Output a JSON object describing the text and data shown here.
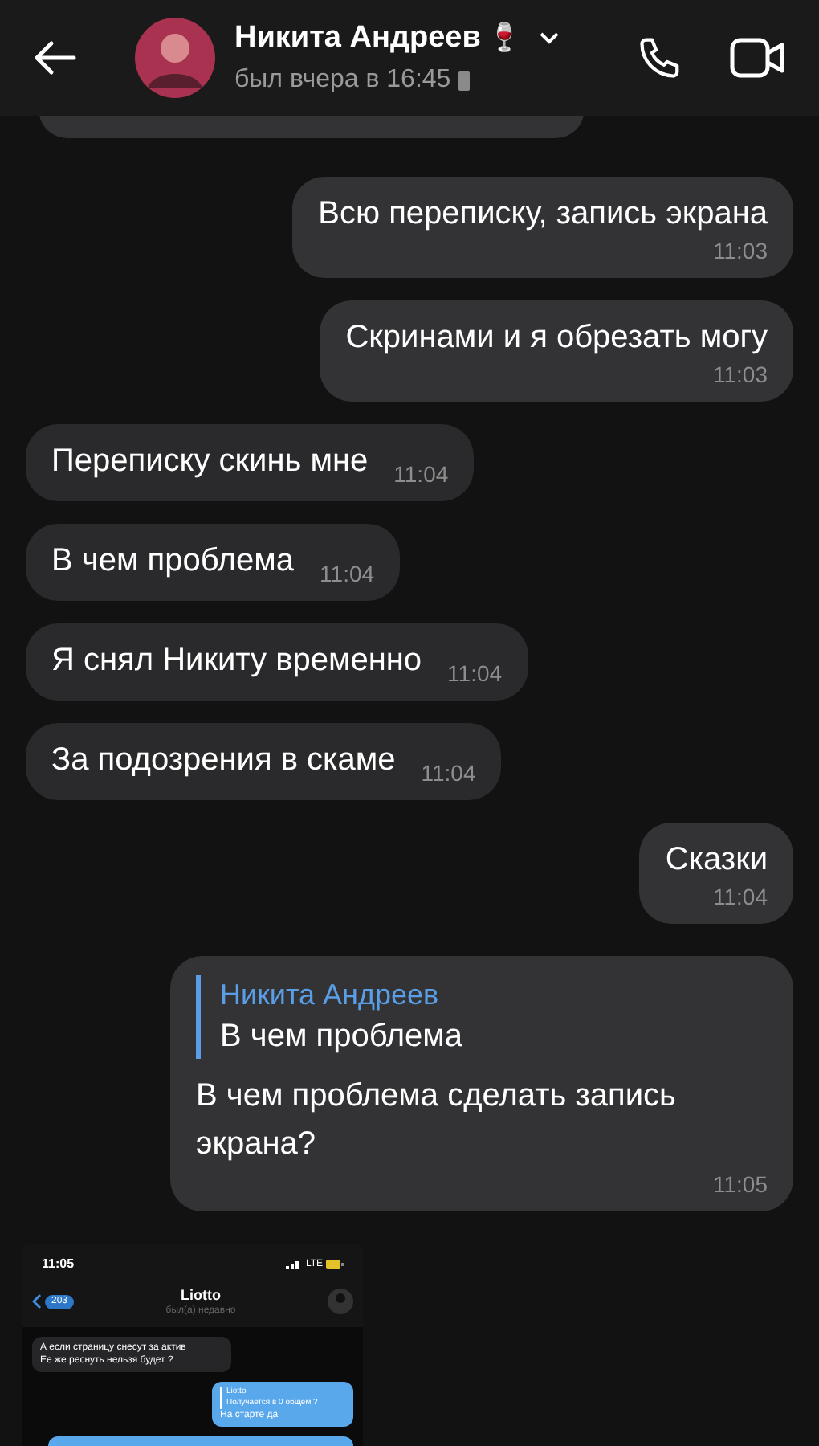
{
  "header": {
    "title": "Никита Андреев",
    "emoji": "🍷",
    "status": "был вчера в 16:45"
  },
  "messages": [
    {
      "kind": "partial",
      "outgoing": true
    },
    {
      "kind": "text",
      "outgoing": true,
      "text": "Всю переписку, запись экрана",
      "time": "11:03"
    },
    {
      "kind": "text",
      "outgoing": true,
      "text": "Скринами и я обрезать могу",
      "time": "11:03"
    },
    {
      "kind": "text",
      "outgoing": false,
      "text": "Переписку скинь мне",
      "time": "11:04"
    },
    {
      "kind": "text",
      "outgoing": false,
      "text": "В чем проблема",
      "time": "11:04"
    },
    {
      "kind": "text",
      "outgoing": false,
      "text": "Я снял Никиту временно",
      "time": "11:04"
    },
    {
      "kind": "text",
      "outgoing": false,
      "text": "За подозрения в скаме",
      "time": "11:04"
    },
    {
      "kind": "text",
      "outgoing": true,
      "text": "Сказки",
      "time": "11:04"
    },
    {
      "kind": "reply",
      "outgoing": true,
      "reply_author": "Никита Андреев",
      "reply_text": "В чем проблема",
      "text": "В чем проблема сделать запись экрана?",
      "time": "11:05"
    },
    {
      "kind": "screenshot",
      "outgoing": false,
      "shot": {
        "clock": "11:05",
        "network": "LTE",
        "back_count": "203",
        "title": "Liotto",
        "subtitle": "был(а) недавно",
        "messages": [
          {
            "outgoing": false,
            "text": "А если страницу снесут за актив\nЕе же реснуть нельзя будет ?"
          },
          {
            "outgoing": true,
            "reply_author": "Liotto",
            "reply_text": "Получается в 0 общем ?",
            "text": "На старте да"
          },
          {
            "outgoing": true
          }
        ]
      }
    }
  ]
}
